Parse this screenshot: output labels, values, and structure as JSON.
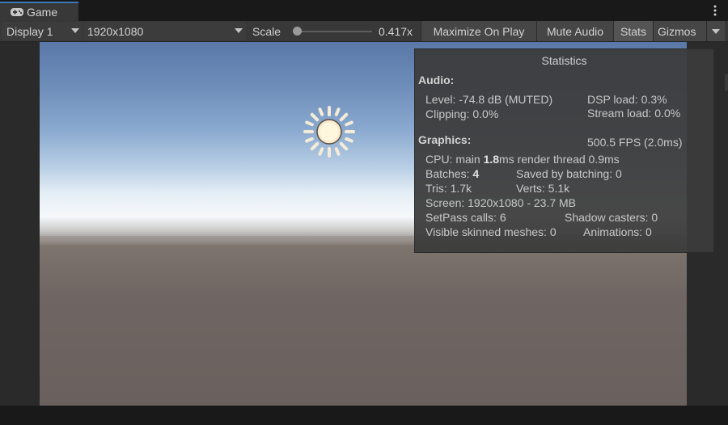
{
  "tab": {
    "icon": "gamepad-icon",
    "label": "Game"
  },
  "toolbar": {
    "display": "Display 1",
    "resolution": "1920x1080",
    "scale_label": "Scale",
    "scale_value": "0.417x",
    "scale_level": 0.0,
    "maximize_label": "Maximize On Play",
    "mute_label": "Mute Audio",
    "stats_label": "Stats",
    "gizmos_label": "Gizmos"
  },
  "stats": {
    "title": "Statistics",
    "audio_heading": "Audio:",
    "level": "Level: -74.8 dB (MUTED)",
    "clipping": "Clipping: 0.0%",
    "dsp_load": "DSP load: 0.3%",
    "stream_load": "Stream load: 0.0%",
    "graphics_heading": "Graphics:",
    "fps": "500.5 FPS (2.0ms)",
    "cpu_prefix": "CPU: main ",
    "cpu_main": "1.8",
    "cpu_suffix": "ms  render thread 0.9ms",
    "batches_prefix": "Batches: ",
    "batches": "4",
    "saved_by_batching": "Saved by batching: 0",
    "tris": "Tris: 1.7k",
    "verts": "Verts: 5.1k",
    "screen": "Screen: 1920x1080 - 23.7 MB",
    "setpass": "SetPass calls: 6",
    "shadow_casters": "Shadow casters: 0",
    "skinned": "Visible skinned meshes: 0",
    "animations": "Animations: 0"
  },
  "colors": {
    "tab_accent": "#3a79bb",
    "toolbar_bg": "#383838",
    "active_toggle": "#545454"
  }
}
